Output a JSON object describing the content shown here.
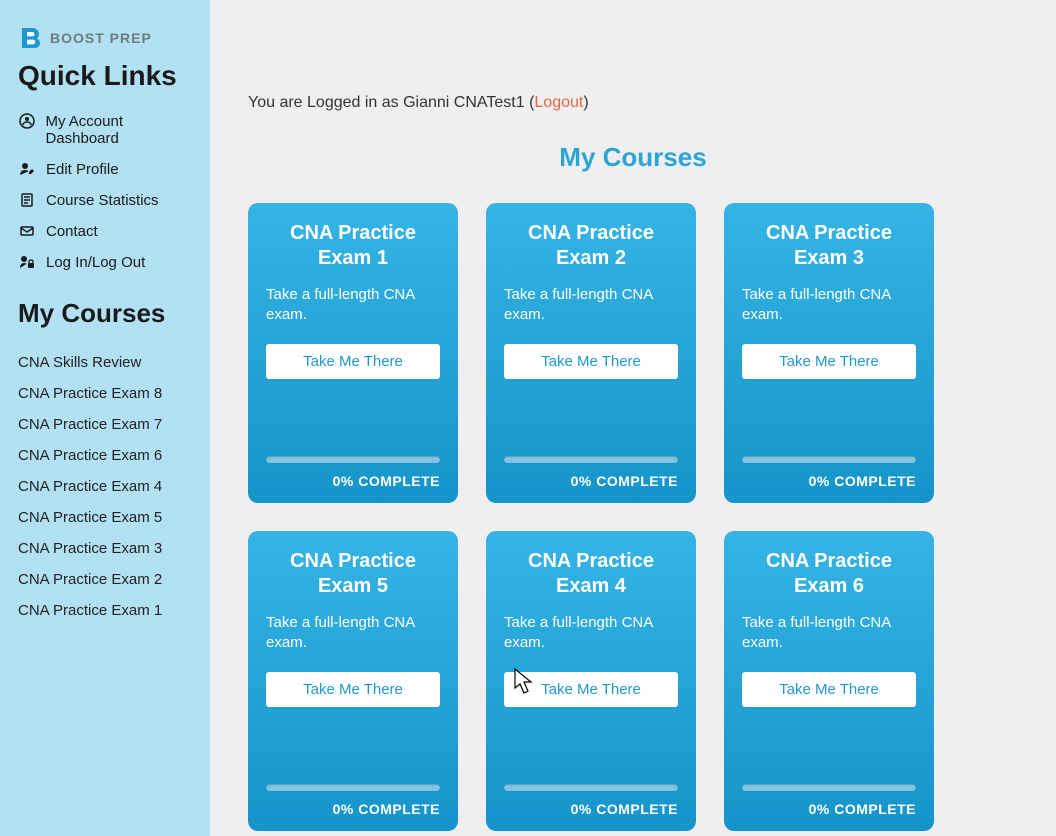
{
  "logo": {
    "brand": "BOOST PREP"
  },
  "sidebar": {
    "quick_links_heading": "Quick Links",
    "items": [
      {
        "icon": "user-circle-icon",
        "label": "My Account Dashboard"
      },
      {
        "icon": "user-edit-icon",
        "label": "Edit Profile"
      },
      {
        "icon": "document-icon",
        "label": "Course Statistics"
      },
      {
        "icon": "envelope-icon",
        "label": "Contact"
      },
      {
        "icon": "lock-user-icon",
        "label": "Log In/Log Out"
      }
    ],
    "my_courses_heading": "My Courses",
    "courses": [
      "CNA Skills Review",
      "CNA Practice Exam 8",
      "CNA Practice Exam 7",
      "CNA Practice Exam 6",
      "CNA Practice Exam 4",
      "CNA Practice Exam 5",
      "CNA Practice Exam 3",
      "CNA Practice Exam 2",
      "CNA Practice Exam 1"
    ]
  },
  "main": {
    "login_status_prefix": "You are Logged in as ",
    "login_status_user": "Gianni CNATest1",
    "login_status_open": " (",
    "logout_label": "Logout",
    "login_status_close": ")",
    "page_title": "My Courses",
    "cards": [
      {
        "title": "CNA Practice Exam 1",
        "desc": "Take a full-length CNA exam.",
        "button": "Take Me There",
        "progress": "0% COMPLETE"
      },
      {
        "title": "CNA Practice Exam 2",
        "desc": "Take a full-length CNA exam.",
        "button": "Take Me There",
        "progress": "0% COMPLETE"
      },
      {
        "title": "CNA Practice Exam 3",
        "desc": "Take a full-length CNA exam.",
        "button": "Take Me There",
        "progress": "0% COMPLETE"
      },
      {
        "title": "CNA Practice Exam 5",
        "desc": "Take a full-length CNA exam.",
        "button": "Take Me There",
        "progress": "0% COMPLETE"
      },
      {
        "title": "CNA Practice Exam 4",
        "desc": "Take a full-length CNA exam.",
        "button": "Take Me There",
        "progress": "0% COMPLETE"
      },
      {
        "title": "CNA Practice Exam 6",
        "desc": "Take a full-length CNA exam.",
        "button": "Take Me There",
        "progress": "0% COMPLETE"
      }
    ]
  }
}
